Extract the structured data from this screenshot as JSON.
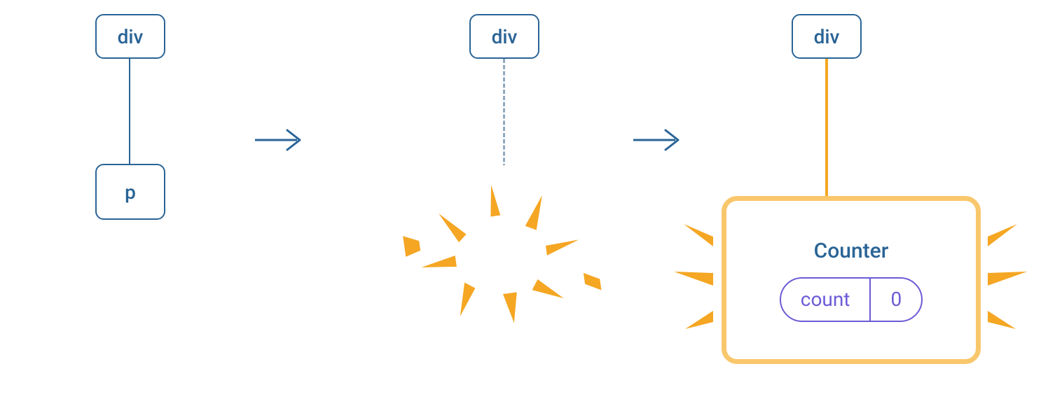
{
  "stage1": {
    "parent_label": "div",
    "child_label": "p"
  },
  "stage2": {
    "parent_label": "div"
  },
  "stage3": {
    "parent_label": "div",
    "counter_title": "Counter",
    "state_key": "count",
    "state_value": "0"
  }
}
